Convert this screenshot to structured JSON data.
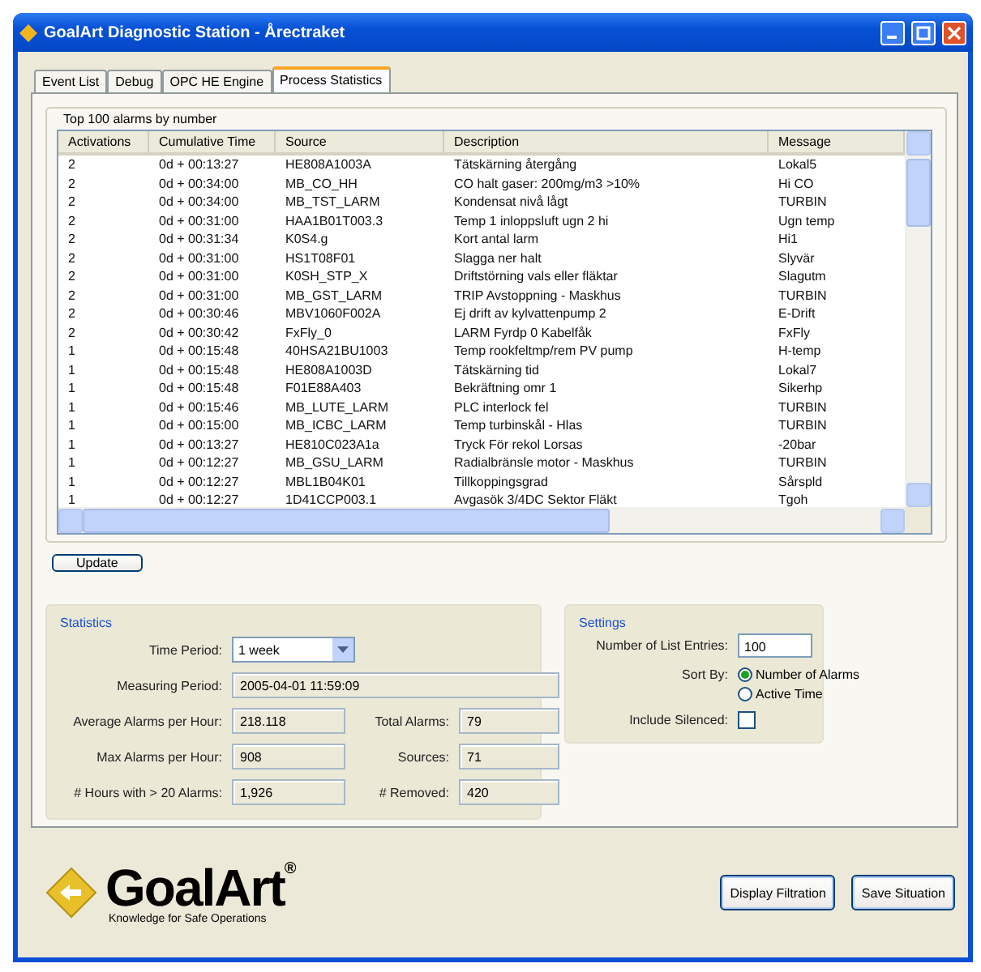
{
  "window": {
    "title": "GoalArt Diagnostic Station - Årectraket"
  },
  "tabs": [
    {
      "label": "Event List",
      "selected": false
    },
    {
      "label": "Debug",
      "selected": false
    },
    {
      "label": "OPC HE Engine",
      "selected": false
    },
    {
      "label": "Process Statistics",
      "selected": true
    }
  ],
  "alarm_list": {
    "title": "Top 100 alarms by number",
    "columns": [
      "Activations",
      "Cumulative Time",
      "Source",
      "Description",
      "Message"
    ],
    "rows": [
      [
        "2",
        "0d + 00:13:27",
        "HE808A1003A",
        "Tätskärning återgång",
        "Lokal5"
      ],
      [
        "2",
        "0d + 00:34:00",
        "MB_CO_HH",
        "CO halt gaser: 200mg/m3 >10%",
        "Hi CO"
      ],
      [
        "2",
        "0d + 00:34:00",
        "MB_TST_LARM",
        "Kondensat nivå lågt",
        "TURBIN"
      ],
      [
        "2",
        "0d + 00:31:00",
        "HAA1B01T003.3",
        "Temp 1 inloppsluft ugn 2 hi",
        "Ugn temp"
      ],
      [
        "2",
        "0d + 00:31:34",
        "K0S4.g",
        "Kort antal larm",
        "Hi1"
      ],
      [
        "2",
        "0d + 00:31:00",
        "HS1T08F01",
        "Slagga ner halt",
        "Slyvär"
      ],
      [
        "2",
        "0d + 00:31:00",
        "K0SH_STP_X",
        "Driftstörning vals eller fläktar",
        "Slagutm"
      ],
      [
        "2",
        "0d + 00:31:00",
        "MB_GST_LARM",
        "TRIP Avstoppning - Maskhus",
        "TURBIN"
      ],
      [
        "2",
        "0d + 00:30:46",
        "MBV1060F002A",
        "Ej drift av kylvattenpump 2",
        "E-Drift"
      ],
      [
        "2",
        "0d + 00:30:42",
        "FxFly_0",
        "LARM Fyrdp 0 Kabelfåk",
        "FxFly"
      ],
      [
        "1",
        "0d + 00:15:48",
        "40HSA21BU1003",
        "Temp rookfeltmp/rem PV pump",
        "H-temp"
      ],
      [
        "1",
        "0d + 00:15:48",
        "HE808A1003D",
        "Tätskärning tid",
        "Lokal7"
      ],
      [
        "1",
        "0d + 00:15:48",
        "F01E88A403",
        "Bekräftning omr 1",
        "Sikerhp"
      ],
      [
        "1",
        "0d + 00:15:46",
        "MB_LUTE_LARM",
        "PLC interlock fel",
        "TURBIN"
      ],
      [
        "1",
        "0d + 00:15:00",
        "MB_ICBC_LARM",
        "Temp turbinskål - Hlas",
        "TURBIN"
      ],
      [
        "1",
        "0d + 00:13:27",
        "HE810C023A1a",
        "Tryck För rekol Lorsas",
        "-20bar"
      ],
      [
        "1",
        "0d + 00:12:27",
        "MB_GSU_LARM",
        "Radialbränsle motor - Maskhus",
        "TURBIN"
      ],
      [
        "1",
        "0d + 00:12:27",
        "MBL1B04K01",
        "Tillkoppingsgrad",
        "Sårspld"
      ],
      [
        "1",
        "0d + 00:12:27",
        "1D41CCP003.1",
        "Avgasök 3/4DC Sektor Fläkt",
        "Tgoh"
      ]
    ]
  },
  "update_button": "Update",
  "statistics": {
    "title": "Statistics",
    "time_period": {
      "label": "Time Period:",
      "value": "1 week"
    },
    "measuring_period": {
      "label": "Measuring Period:",
      "value": "2005-04-01 11:59:09"
    },
    "pairs": [
      [
        {
          "label": "Average Alarms per Hour:",
          "value": "218.118"
        },
        {
          "label": "Total Alarms:",
          "value": "79"
        }
      ],
      [
        {
          "label": "Max Alarms per Hour:",
          "value": "908"
        },
        {
          "label": "Sources:",
          "value": "71"
        }
      ],
      [
        {
          "label": "# Hours with > 20 Alarms:",
          "value": "1,926"
        },
        {
          "label": "# Removed:",
          "value": "420"
        }
      ]
    ]
  },
  "settings": {
    "title": "Settings",
    "list_entries": {
      "label": "Number of List Entries:",
      "value": "100"
    },
    "sort_by": {
      "label": "Sort By:",
      "options": [
        {
          "label": "Number of Alarms",
          "selected": true
        },
        {
          "label": "Active Time",
          "selected": false
        }
      ]
    },
    "include_silenced": {
      "label": "Include Silenced:",
      "checked": false
    }
  },
  "logo": {
    "name": "GoalArt",
    "mark": "®",
    "tagline": "Knowledge for Safe Operations"
  },
  "buttons": [
    "Display Filtration",
    "Save Situation"
  ]
}
